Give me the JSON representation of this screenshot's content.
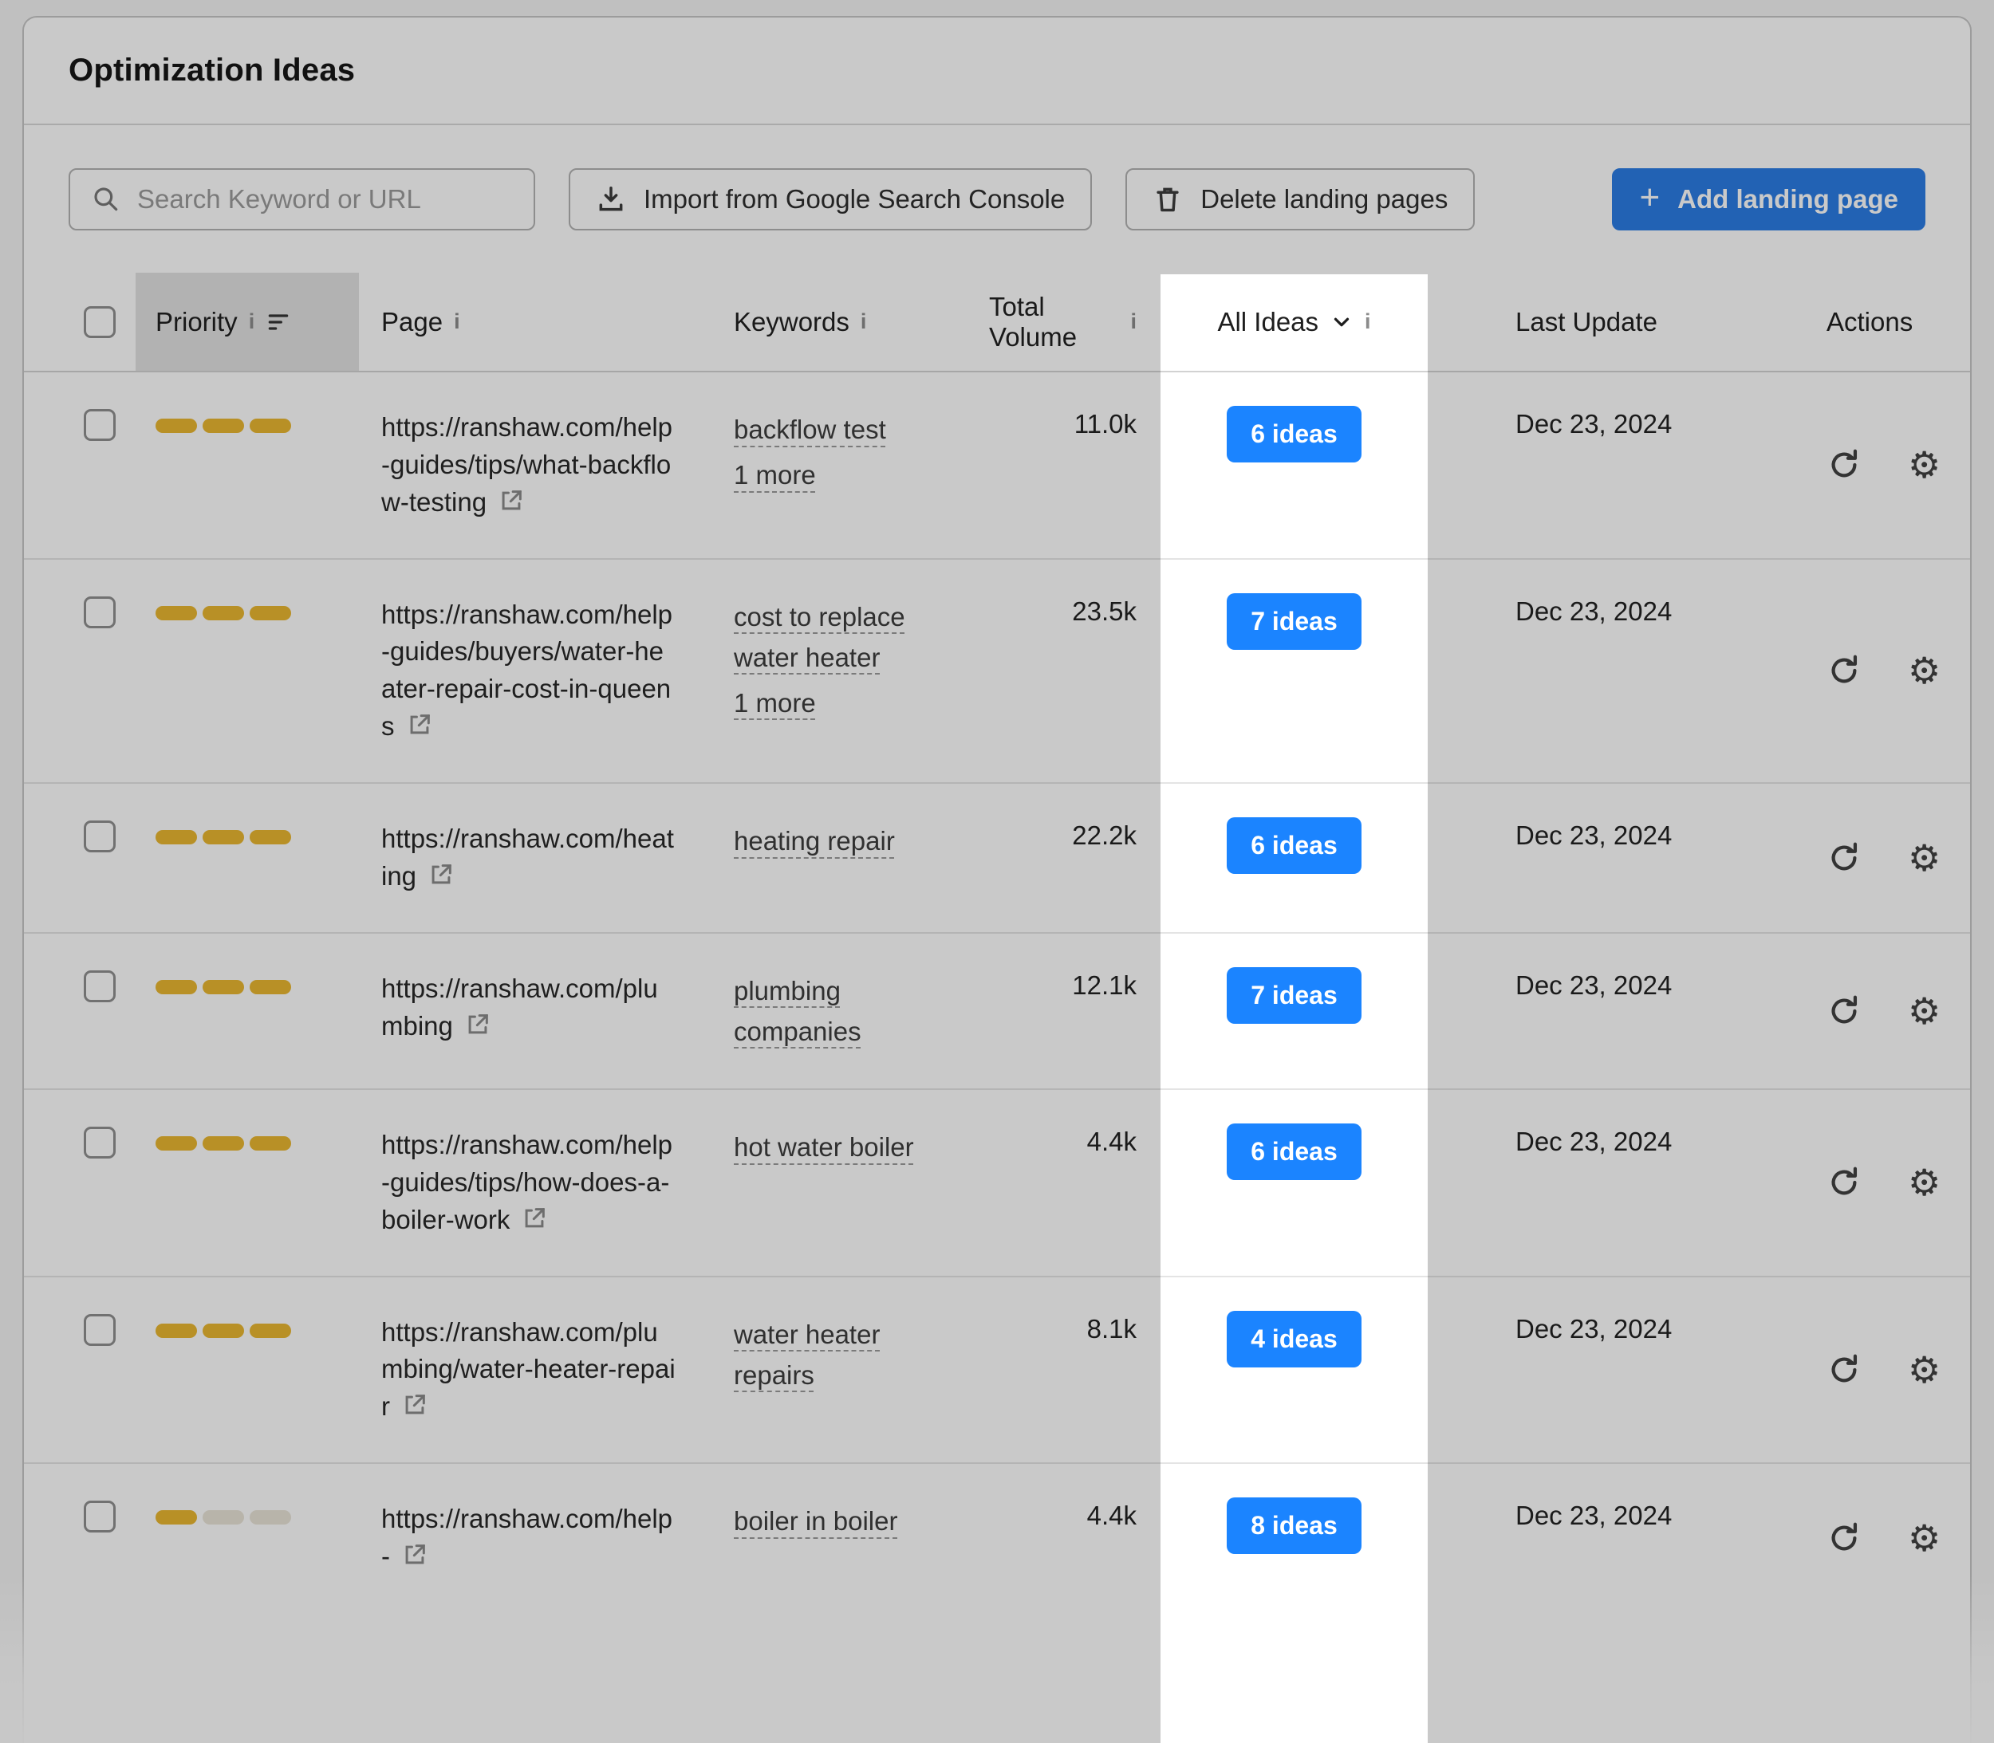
{
  "title": "Optimization Ideas",
  "toolbar": {
    "search_placeholder": "Search Keyword or URL",
    "import_label": "Import from Google Search Console",
    "delete_label": "Delete landing pages",
    "add_label": "Add landing page"
  },
  "icons": {
    "plus": "+",
    "gear": "⚙",
    "info": "i"
  },
  "colors": {
    "accent_blue": "#1b84ff",
    "button_blue": "#2a7be4",
    "priority_orange": "#eab72f"
  },
  "table": {
    "headers": {
      "priority": "Priority",
      "page": "Page",
      "keywords": "Keywords",
      "total_volume": "Total Volume",
      "all_ideas": "All Ideas",
      "last_update": "Last Update",
      "actions": "Actions"
    },
    "rows": [
      {
        "priority": 3,
        "url": "https://ranshaw.com/help-guides/tips/what-backflow-testing",
        "keyword": "backflow test",
        "more": "1 more",
        "volume": "11.0k",
        "ideas": "6 ideas",
        "updated": "Dec 23, 2024",
        "faded": false
      },
      {
        "priority": 3,
        "url": "https://ranshaw.com/help-guides/buyers/water-heater-repair-cost-in-queens",
        "keyword": "cost to replace water heater",
        "more": "1 more",
        "volume": "23.5k",
        "ideas": "7 ideas",
        "updated": "Dec 23, 2024",
        "faded": false
      },
      {
        "priority": 3,
        "url": "https://ranshaw.com/heating",
        "keyword": "heating repair",
        "volume": "22.2k",
        "ideas": "6 ideas",
        "updated": "Dec 23, 2024",
        "faded": false
      },
      {
        "priority": 3,
        "url": "https://ranshaw.com/plumbing",
        "keyword": "plumbing companies",
        "volume": "12.1k",
        "ideas": "7 ideas",
        "updated": "Dec 23, 2024",
        "faded": false
      },
      {
        "priority": 3,
        "url": "https://ranshaw.com/help-guides/tips/how-does-a-boiler-work",
        "keyword": "hot water boiler",
        "volume": "4.4k",
        "ideas": "6 ideas",
        "updated": "Dec 23, 2024",
        "faded": false
      },
      {
        "priority": 3,
        "url": "https://ranshaw.com/plumbing/water-heater-repair",
        "keyword": "water heater repairs",
        "volume": "8.1k",
        "ideas": "4 ideas",
        "updated": "Dec 23, 2024",
        "faded": false
      },
      {
        "priority": 1,
        "url": "https://ranshaw.com/help-",
        "keyword": "boiler in boiler",
        "volume": "4.4k",
        "ideas": "8 ideas",
        "updated": "Dec 23, 2024",
        "faded": true
      }
    ]
  }
}
